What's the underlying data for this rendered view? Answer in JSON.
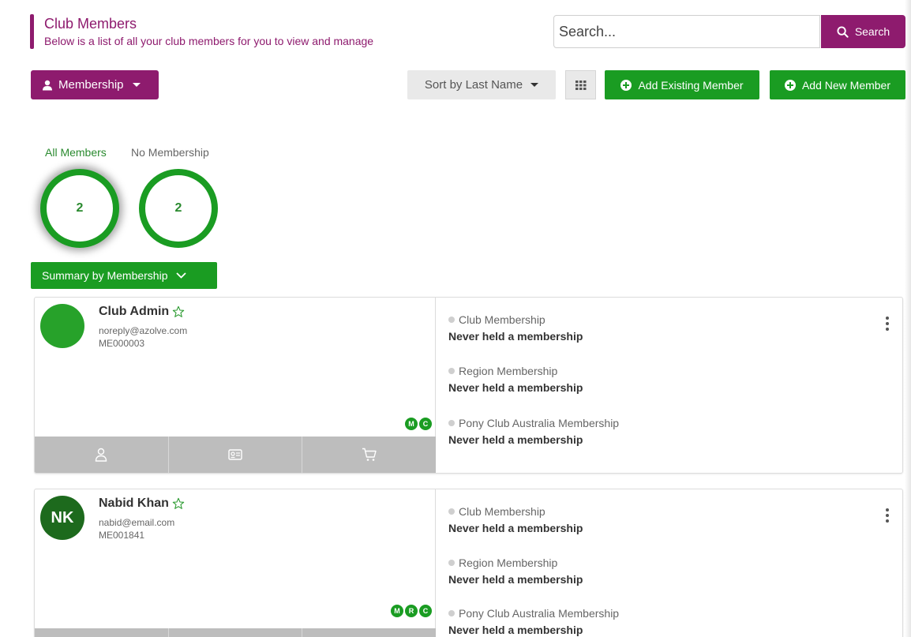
{
  "header": {
    "title": "Club Members",
    "subtitle": "Below is a list of all your club members for you to view and manage"
  },
  "search": {
    "placeholder": "Search...",
    "button_label": "Search"
  },
  "toolbar": {
    "membership_dropdown_label": "Membership",
    "sort_label": "Sort by Last Name",
    "add_existing_label": "Add Existing Member",
    "add_new_label": "Add New Member"
  },
  "filters": [
    {
      "label": "All Members",
      "count": "2"
    },
    {
      "label": "No Membership",
      "count": "2"
    }
  ],
  "summary_button_label": "Summary by Membership",
  "members": [
    {
      "name": "Club Admin",
      "initials": "",
      "email": "noreply@azolve.com",
      "member_id": "ME000003",
      "badges": [
        "M",
        "C"
      ],
      "memberships": [
        {
          "name": "Club Membership",
          "status": "Never held a membership"
        },
        {
          "name": "Region Membership",
          "status": "Never held a membership"
        },
        {
          "name": "Pony Club Australia Membership",
          "status": "Never held a membership"
        }
      ]
    },
    {
      "name": "Nabid Khan",
      "initials": "NK",
      "email": "nabid@email.com",
      "member_id": "ME001841",
      "badges": [
        "M",
        "R",
        "C"
      ],
      "memberships": [
        {
          "name": "Club Membership",
          "status": "Never held a membership"
        },
        {
          "name": "Region Membership",
          "status": "Never held a membership"
        },
        {
          "name": "Pony Club Australia Membership",
          "status": "Never held a membership"
        }
      ]
    }
  ],
  "colors": {
    "brand_purple": "#8e1b6e",
    "action_green": "#1a9c22",
    "count_green": "#2a8a2f"
  },
  "icons": {
    "search": "search-icon",
    "user": "user-icon",
    "grid": "grid-icon",
    "plus": "plus-circle-icon",
    "star": "star-outline-icon",
    "kebab": "kebab-menu-icon",
    "profile": "person-icon",
    "id_card": "id-card-icon",
    "cart": "cart-icon"
  }
}
